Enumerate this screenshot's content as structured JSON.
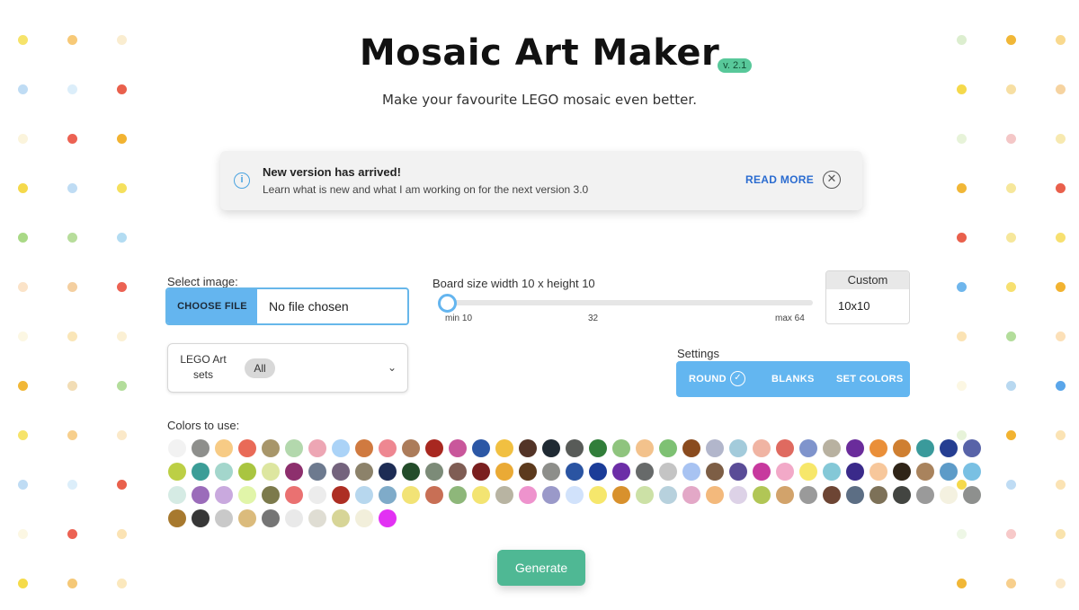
{
  "header": {
    "title": "Mosaic Art Maker",
    "version": "v. 2.1",
    "subtitle": "Make your favourite LEGO mosaic even better."
  },
  "alert": {
    "icon": "info-icon",
    "title": "New version has arrived!",
    "text": "Learn what is new and what I am working on for the next version 3.0",
    "read_more": "READ MORE",
    "close_icon": "close-circle-icon"
  },
  "image_select": {
    "label": "Select image:",
    "button": "CHOOSE FILE",
    "value": "No file chosen"
  },
  "board": {
    "label": "Board size  width 10 x height 10",
    "min_label": "min 10",
    "mid_label": "32",
    "max_label": "max 64",
    "value": 10,
    "min": 10,
    "max": 64
  },
  "custom": {
    "label": "Custom",
    "value": "10x10"
  },
  "sets": {
    "label": "LEGO Art sets",
    "chip": "All",
    "chevron_icon": "chevron-down-icon"
  },
  "settings": {
    "label": "Settings",
    "round": "ROUND",
    "round_icon": "check-circle-icon",
    "blanks": "BLANKS",
    "set_colors": "SET COLORS",
    "accent": "#63b6f0"
  },
  "colors": {
    "label": "Colors to use:",
    "rows": [
      [
        "#f2f2f2",
        "#8e8f8c",
        "#f7cb85",
        "#e96a57",
        "#a8966a",
        "#b3d8ad",
        "#eda6b4",
        "#abd3f7",
        "#d07a40",
        "#ee8791",
        "#ac7c5a",
        "#a82820",
        "#c9579b",
        "#2c57a5",
        "#f1c041",
        "#533427",
        "#1f2a33",
        "#585b58",
        "#317e3a",
        "#8fc47e",
        "#f3c28c",
        "#7ec173",
        "#8a4b1e",
        "#b2b6cb",
        "#a3cbdb",
        "#f0b4a3",
        "#df6a60",
        "#7f94cc",
        "#b8b1a0",
        "#6a2c9b",
        "#ea8f39",
        "#cf7f31",
        "#3a9a9b",
        "#253e92",
        "#5863a8"
      ],
      [
        "#bccf45",
        "#3b9d97",
        "#a3d6cc",
        "#a9c540",
        "#dde6a0",
        "#8d2f6d",
        "#6d7a8f",
        "#74637d",
        "#8c826a",
        "#1d2c54",
        "#234c2a",
        "#7c8b78",
        "#7f5d54",
        "#7a1f1f",
        "#eaaa35",
        "#5c3a1d",
        "#8d8e8a",
        "#2a54a2",
        "#1b3c98",
        "#6c2ea7",
        "#676a6a",
        "#c4c4c4",
        "#a8c3f2",
        "#7d5e45",
        "#5a4c97",
        "#c7399e",
        "#f2a9c8",
        "#f7e76a",
        "#84c8d7",
        "#3a2a8a",
        "#f7c79b",
        "#2f2417",
        "#a9835d",
        "#5d9bc8",
        "#79c0e3"
      ],
      [
        "#d5ebe4",
        "#9b6cba",
        "#c9a9de",
        "#e1f5a9",
        "#7c7a4c",
        "#ea7171",
        "#ececec",
        "#ad2e23",
        "#b7d7ee",
        "#7fabc9",
        "#f2e376",
        "#c86f55",
        "#8eb77a",
        "#f3e472",
        "#b8b4a2",
        "#ee93cd",
        "#9a99c9",
        "#d1e2fb",
        "#f6e76c",
        "#d8912d",
        "#cce1a6",
        "#b7d1dd",
        "#e3a8c7",
        "#f3b97c",
        "#ddd2e7",
        "#b1c656",
        "#d2a36b",
        "#9a9a9a",
        "#6d4534",
        "#5c6e84",
        "#7d7158",
        "#434541",
        "#9a9a9a",
        "#f4f1e0",
        "#8e908e"
      ],
      [
        "#a7792e",
        "#373737",
        "#c9c9c9",
        "#dbbb7c",
        "#757575",
        "#e9e9e9",
        "#dfddd3",
        "#d7d597",
        "#f2efdb",
        "#e231f3"
      ]
    ]
  },
  "generate": {
    "label": "Generate",
    "color": "#4fb894"
  },
  "decor": {
    "left_cols": [
      [
        "#f6e36a",
        "#f7c977",
        "#faedd0"
      ],
      [
        "#bfdcf4",
        "#dceefa",
        "#e9604c"
      ],
      [
        "#fbf4dc",
        "#ec6253",
        "#f2b331"
      ],
      [
        "#f5d94b",
        "#bfdcf4",
        "#f5e05d"
      ],
      [
        "#a9d986",
        "#b7dd9b",
        "#b3dcf2"
      ],
      [
        "#fbe3c8",
        "#f4cfa0",
        "#ec6253"
      ],
      [
        "#fcf7e3",
        "#fae6b8",
        "#fbf0d4"
      ],
      [
        "#f1b737",
        "#f2ddb5",
        "#b3dd9b"
      ],
      [
        "#f6e36a",
        "#f7cf8d",
        "#fbe9c9"
      ],
      [
        "#bfdcf4",
        "#dceefa",
        "#e9604c"
      ],
      [
        "#fcf7e3",
        "#ec6253",
        "#fbe3b4"
      ],
      [
        "#f5db4a",
        "#f5c877",
        "#fbe8bd"
      ]
    ],
    "right_cols": [
      [
        "#dceecf",
        "#f1b737",
        "#f9d98e"
      ],
      [
        "#f5d94b",
        "#f7dfa3",
        "#f6d3a0"
      ],
      [
        "#e7f3d9",
        "#f4c7c7",
        "#f7e9b0"
      ],
      [
        "#f1b737",
        "#f6e79b",
        "#e9604c"
      ],
      [
        "#e9604c",
        "#f6e79b",
        "#f7e070"
      ],
      [
        "#6fb6ec",
        "#f7e070",
        "#f2b331"
      ],
      [
        "#fbe3b4",
        "#b3dd9b",
        "#fce0b8"
      ],
      [
        "#fcf7e3",
        "#b8d8f0",
        "#5aa6ea"
      ],
      [
        "#e7f3d9",
        "#f2b331",
        "#fbe3b4"
      ],
      [
        "#f5d94b",
        "#bfdcf4",
        "#fbe3b4"
      ],
      [
        "#eef7e6",
        "#f7c9c9",
        "#f9e3ad"
      ],
      [
        "#f1b737",
        "#f7cf8d",
        "#fbe9c9"
      ]
    ]
  }
}
